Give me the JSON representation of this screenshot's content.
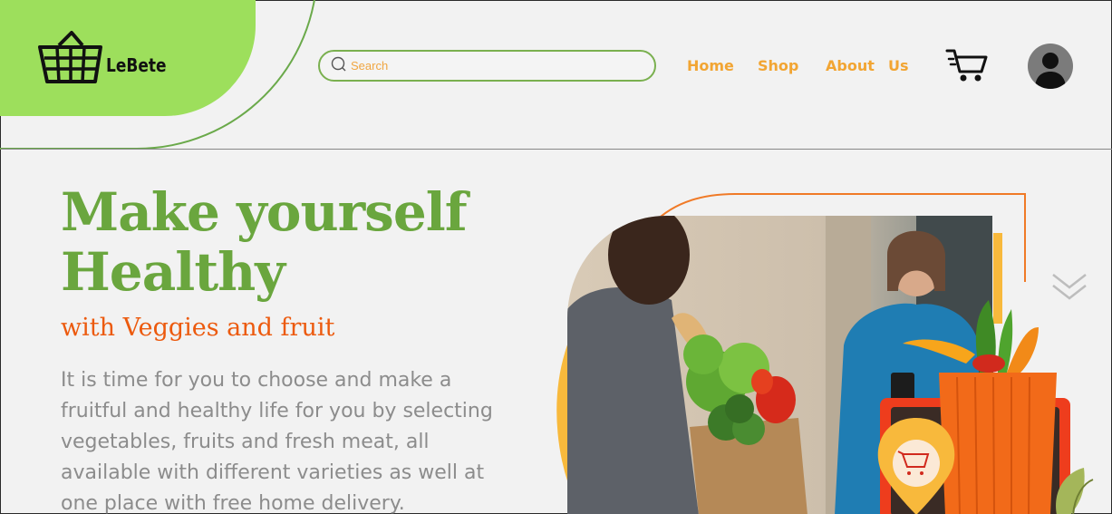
{
  "brand": {
    "name": "LeBete",
    "logo_icon": "basket-icon"
  },
  "search": {
    "placeholder": "Search",
    "icon": "search-icon"
  },
  "nav": {
    "items": [
      "Home",
      "Shop",
      "About",
      "Us"
    ]
  },
  "header_icons": {
    "cart": "cart-icon",
    "profile": "user-icon"
  },
  "hero": {
    "title_line1": "Make yourself",
    "title_line2": "Healthy",
    "subtitle": "with Veggies and fruit",
    "body": "It is time for you to choose and make a fruitful and healthy life for you by selecting vegetables, fruits and fresh meat, all available with different varieties as well at one place with free home delivery."
  },
  "colors": {
    "brand_green": "#9ddf5c",
    "title_green": "#6aa63e",
    "accent_orange": "#ec5a0e",
    "nav_orange": "#f2a533",
    "background": "#f2f2f2"
  }
}
